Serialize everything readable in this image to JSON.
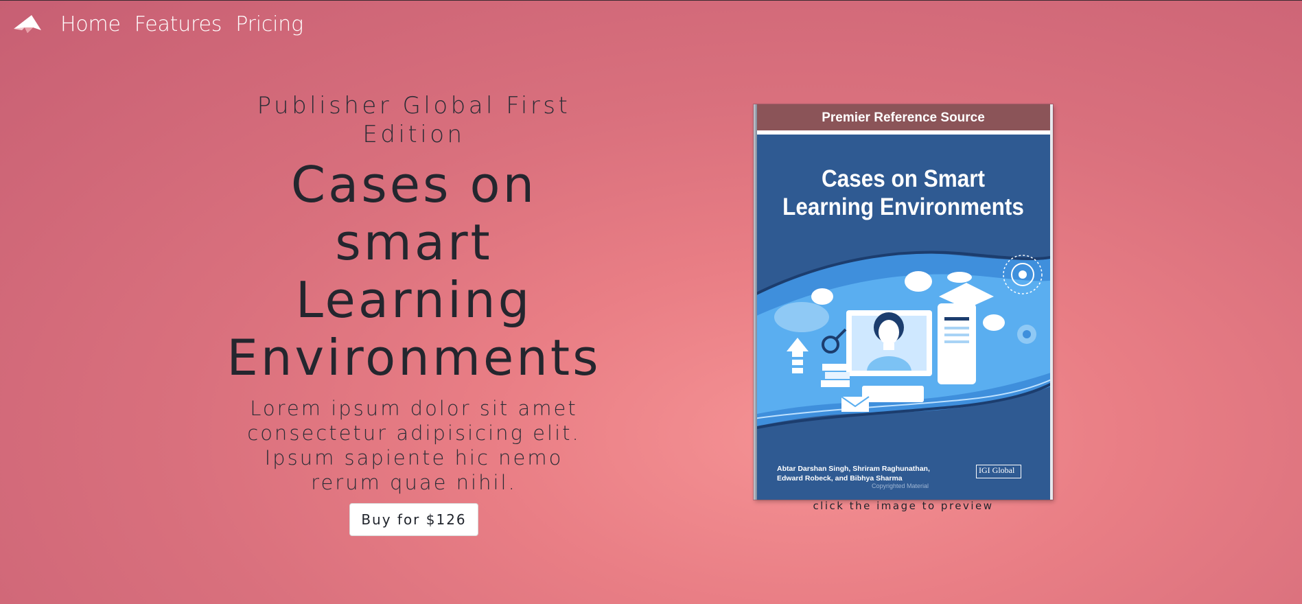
{
  "nav": {
    "logo_icon": "paper-plane-icon",
    "items": [
      {
        "label": "Home"
      },
      {
        "label": "Features"
      },
      {
        "label": "Pricing"
      }
    ]
  },
  "hero": {
    "publisher": "Publisher Global First Edition",
    "title": "Cases on smart Learning Environments",
    "description": "Lorem ipsum dolor sit amet consectetur adipisicing elit. Ipsum sapiente hic nemo rerum quae nihil.",
    "buy_label": "Buy for $126"
  },
  "book_cover": {
    "banner": "Premier Reference Source",
    "title_line1": "Cases on Smart",
    "title_line2": "Learning Environments",
    "authors_line1": "Abtar Darshan Singh, Shriram Raghunathan,",
    "authors_line2": "Edward Robeck, and Bibhya Sharma",
    "copyright": "Copyrighted Material",
    "publisher_logo": "IGI Global",
    "caption": "click the image to preview"
  },
  "colors": {
    "background_start": "#c75f73",
    "background_glow": "#f59294",
    "text_dark": "#262a33",
    "cover_blue": "#2f5a92",
    "cover_banner": "#8b5458"
  }
}
